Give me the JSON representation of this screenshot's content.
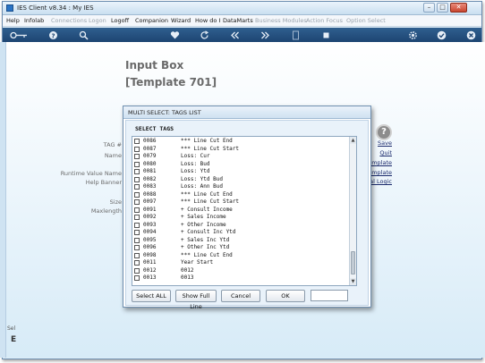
{
  "window": {
    "title": "IES Client v8.34 : My IES"
  },
  "menu": [
    {
      "label": "Help",
      "enabled": true
    },
    {
      "label": "Infolab",
      "enabled": true
    },
    {
      "label": "Connections",
      "enabled": false
    },
    {
      "label": "Logon",
      "enabled": false
    },
    {
      "label": "Logoff",
      "enabled": true
    },
    {
      "label": "Companion",
      "enabled": true
    },
    {
      "label": "Wizard",
      "enabled": true
    },
    {
      "label": "How do I",
      "enabled": true
    },
    {
      "label": "DataMarts",
      "enabled": true
    },
    {
      "label": "Business Modules",
      "enabled": false
    },
    {
      "label": "Action Focus",
      "enabled": false
    },
    {
      "label": "Option Select",
      "enabled": false
    }
  ],
  "toolbar_icons": [
    "key-icon",
    "help-icon",
    "search-icon",
    "heart-icon",
    "refresh-icon",
    "rewind-icon",
    "fast-forward-icon",
    "document-icon",
    "stop-icon",
    "gear-icon",
    "check-icon",
    "close-icon"
  ],
  "page": {
    "title": "Input Box",
    "subtitle": "[Template 701]",
    "field_labels": [
      "TAG #",
      "Name",
      "Runtime Value Name",
      "Help Banner",
      "Size",
      "Maxlength"
    ],
    "help_symbol": "?",
    "right_links": [
      "Save",
      "Quit",
      "emplate",
      "emplate",
      "al Logic"
    ],
    "left_strip_text": [
      "Sel",
      "E"
    ]
  },
  "dialog": {
    "title": "MULTI SELECT: TAGS LIST",
    "heading": "SELECT TAGS",
    "rows": [
      {
        "code": "0086",
        "desc": "*** Line Cut End"
      },
      {
        "code": "0087",
        "desc": "*** Line Cut Start"
      },
      {
        "code": "0079",
        "desc": "Loss: Cur"
      },
      {
        "code": "0080",
        "desc": "Loss: Bud"
      },
      {
        "code": "0081",
        "desc": "Loss: Ytd"
      },
      {
        "code": "0082",
        "desc": "Loss: Ytd Bud"
      },
      {
        "code": "0083",
        "desc": "Loss: Ann Bud"
      },
      {
        "code": "0088",
        "desc": "*** Line Cut End"
      },
      {
        "code": "0097",
        "desc": "*** Line Cut Start"
      },
      {
        "code": "0091",
        "desc": "+ Consult Income"
      },
      {
        "code": "0092",
        "desc": "+ Sales Income"
      },
      {
        "code": "0093",
        "desc": "+ Other Income"
      },
      {
        "code": "0094",
        "desc": "+ Consult Inc Ytd"
      },
      {
        "code": "0095",
        "desc": "+ Sales Inc Ytd"
      },
      {
        "code": "0096",
        "desc": "+ Other Inc Ytd"
      },
      {
        "code": "0098",
        "desc": "*** Line Cut End"
      },
      {
        "code": "0011",
        "desc": "Year Start"
      },
      {
        "code": "0012",
        "desc": "0012"
      },
      {
        "code": "0013",
        "desc": "0013"
      }
    ],
    "buttons": {
      "select_all": "Select ALL",
      "show_full_line": "Show Full Line",
      "cancel": "Cancel",
      "ok": "OK"
    },
    "input_value": ""
  }
}
